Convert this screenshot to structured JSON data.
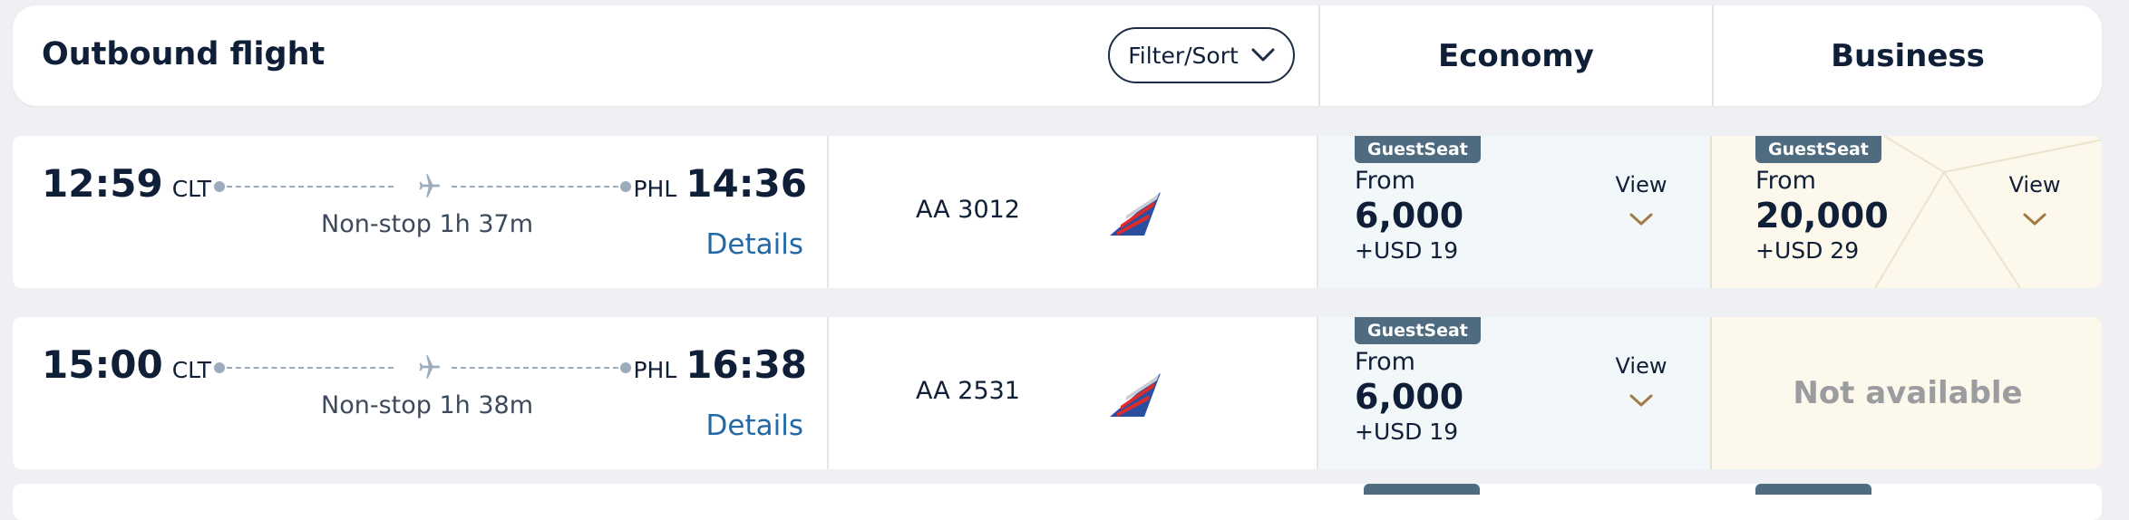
{
  "header": {
    "title": "Outbound flight",
    "filter_label": "Filter/Sort",
    "economy_label": "Economy",
    "business_label": "Business"
  },
  "flights": [
    {
      "dep_time": "12:59",
      "dep_code": "CLT",
      "arr_code": "PHL",
      "arr_time": "14:36",
      "stops": "Non-stop 1h 37m",
      "details_label": "Details",
      "flight_number": "AA 3012",
      "economy": {
        "badge": "GuestSeat",
        "from": "From",
        "points": "6,000",
        "fee": "+USD 19",
        "view": "View"
      },
      "business": {
        "badge": "GuestSeat",
        "from": "From",
        "points": "20,000",
        "fee": "+USD 29",
        "view": "View"
      }
    },
    {
      "dep_time": "15:00",
      "dep_code": "CLT",
      "arr_code": "PHL",
      "arr_time": "16:38",
      "stops": "Non-stop 1h 38m",
      "details_label": "Details",
      "flight_number": "AA 2531",
      "economy": {
        "badge": "GuestSeat",
        "from": "From",
        "points": "6,000",
        "fee": "+USD 19",
        "view": "View"
      },
      "business": {
        "not_available": "Not available"
      }
    }
  ],
  "icons": {
    "filter": "chevron-down-icon",
    "route": "plane-icon",
    "airline": "american-airlines-tail-logo",
    "view": "chevron-down-icon"
  },
  "colors": {
    "link": "#2369a5",
    "badge": "#4f6b80",
    "economy_bg": "#f2f8f9",
    "business_bg": "#fdf8ec",
    "view_chevron": "#a27a45"
  }
}
